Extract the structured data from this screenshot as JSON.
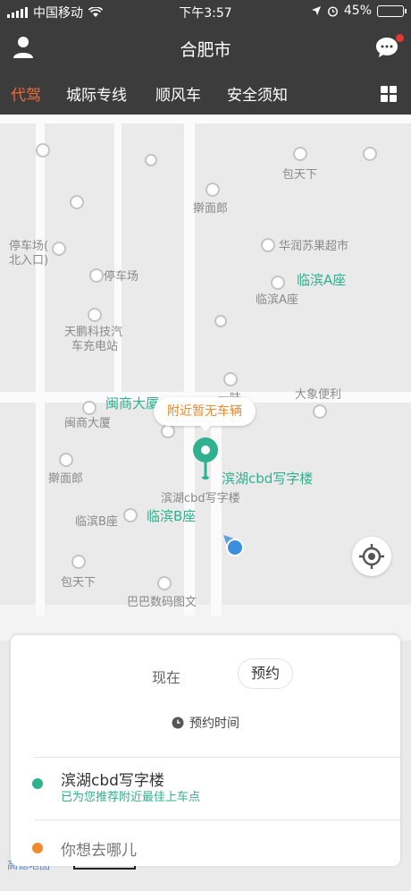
{
  "status_bar": {
    "carrier": "中国移动",
    "time": "下午3:57",
    "battery_pct": "45%",
    "battery_level": 0.45
  },
  "header": {
    "city": "合肥市",
    "has_unread": true
  },
  "tabs": [
    {
      "label": "代驾",
      "active": true
    },
    {
      "label": "城际专线",
      "active": false
    },
    {
      "label": "顺风车",
      "active": false
    },
    {
      "label": "安全须知",
      "active": false
    }
  ],
  "map": {
    "tooltip": "附近暂无车辆",
    "pois": {
      "baotianxia_1": "包天下",
      "ganmianlang_1": "擀面郎",
      "huarun": "华润苏果超市",
      "parking_north": "停车场(",
      "parking_north_2": "北入口)",
      "parking": "停车场",
      "linbin_a_green": "临滨A座",
      "linbin_a": "临滨A座",
      "tianpeng_1": "天鹏科技汽",
      "tianpeng_2": "车充电站",
      "minshang_green": "闽商大厦",
      "minshang": "闽商大厦",
      "weiwei": "一味",
      "daxiang": "大象便利",
      "ganmianlang_2": "擀面郎",
      "binhu_green": "滨湖cbd写字楼",
      "binhu": "滨湖cbd写字楼",
      "linbin_b": "临滨B座",
      "linbin_b_green": "临滨B座",
      "baotianxia_2": "包天下",
      "baba": "巴巴数码图文"
    },
    "map_logo": "高德地图"
  },
  "colors": {
    "accent": "#f06a3a",
    "brand_green": "#2fb08f",
    "dest_orange": "#f08a2c",
    "bar_bg": "#3c3c3c"
  },
  "card": {
    "mode_now": "现在",
    "mode_book": "预约",
    "time_label": "预约时间",
    "from_title": "滨湖cbd写字楼",
    "from_sub": "已为您推荐附近最佳上车点",
    "to_placeholder": "你想去哪儿"
  }
}
